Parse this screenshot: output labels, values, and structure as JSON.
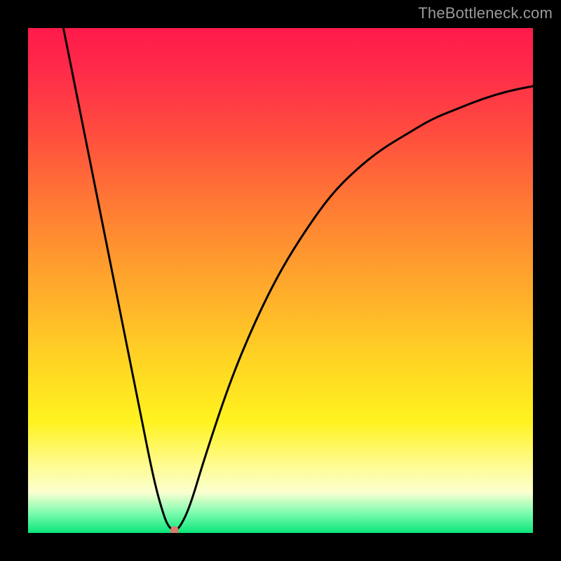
{
  "watermark": "TheBottleneck.com",
  "chart_data": {
    "type": "line",
    "title": "",
    "xlabel": "",
    "ylabel": "",
    "xlim": [
      0,
      100
    ],
    "ylim": [
      0,
      100
    ],
    "grid": false,
    "legend": false,
    "background": "rainbow-vertical",
    "series": [
      {
        "name": "bottleneck-curve",
        "color": "#000000",
        "points": [
          {
            "x": 7,
            "y": 100
          },
          {
            "x": 10,
            "y": 85
          },
          {
            "x": 14,
            "y": 65
          },
          {
            "x": 18,
            "y": 45
          },
          {
            "x": 22,
            "y": 25
          },
          {
            "x": 25,
            "y": 10
          },
          {
            "x": 27,
            "y": 3
          },
          {
            "x": 28,
            "y": 1
          },
          {
            "x": 29,
            "y": 0.5
          },
          {
            "x": 30,
            "y": 1
          },
          {
            "x": 32,
            "y": 5
          },
          {
            "x": 35,
            "y": 15
          },
          {
            "x": 40,
            "y": 30
          },
          {
            "x": 45,
            "y": 42
          },
          {
            "x": 50,
            "y": 52
          },
          {
            "x": 55,
            "y": 60
          },
          {
            "x": 60,
            "y": 67
          },
          {
            "x": 65,
            "y": 72
          },
          {
            "x": 70,
            "y": 76
          },
          {
            "x": 75,
            "y": 79
          },
          {
            "x": 80,
            "y": 82
          },
          {
            "x": 85,
            "y": 84
          },
          {
            "x": 90,
            "y": 86
          },
          {
            "x": 95,
            "y": 87.5
          },
          {
            "x": 100,
            "y": 88.5
          }
        ]
      }
    ],
    "marker": {
      "x": 29,
      "y": 0.5,
      "color": "#d97a6a",
      "r": 6
    }
  }
}
